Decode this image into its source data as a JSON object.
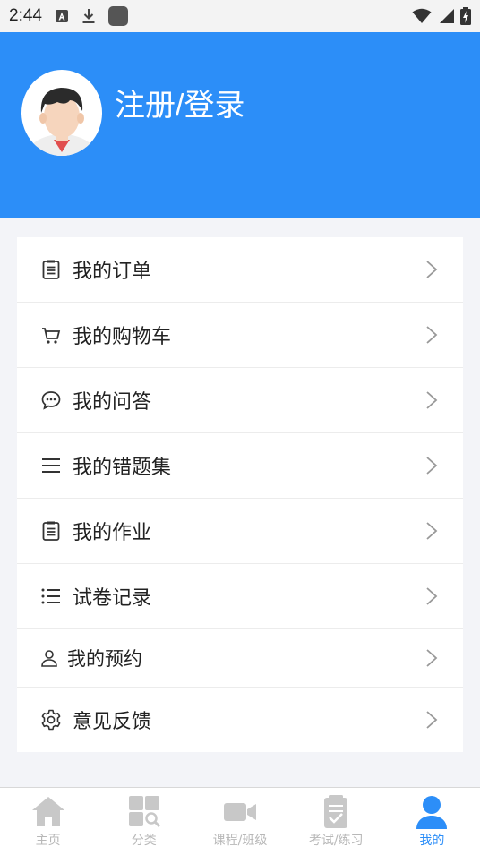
{
  "status_bar": {
    "time": "2:44"
  },
  "header": {
    "title": "注册/登录"
  },
  "menu": [
    {
      "label": "我的订单"
    },
    {
      "label": "我的购物车"
    },
    {
      "label": "我的问答"
    },
    {
      "label": "我的错题集"
    },
    {
      "label": "我的作业"
    },
    {
      "label": "试卷记录"
    },
    {
      "label": "我的预约"
    },
    {
      "label": "意见反馈"
    }
  ],
  "bottom_nav": [
    {
      "label": "主页"
    },
    {
      "label": "分类"
    },
    {
      "label": "课程/班级"
    },
    {
      "label": "考试/练习"
    },
    {
      "label": "我的"
    }
  ],
  "colors": {
    "accent": "#2c8ef8",
    "inactive": "#b8b8b8"
  }
}
